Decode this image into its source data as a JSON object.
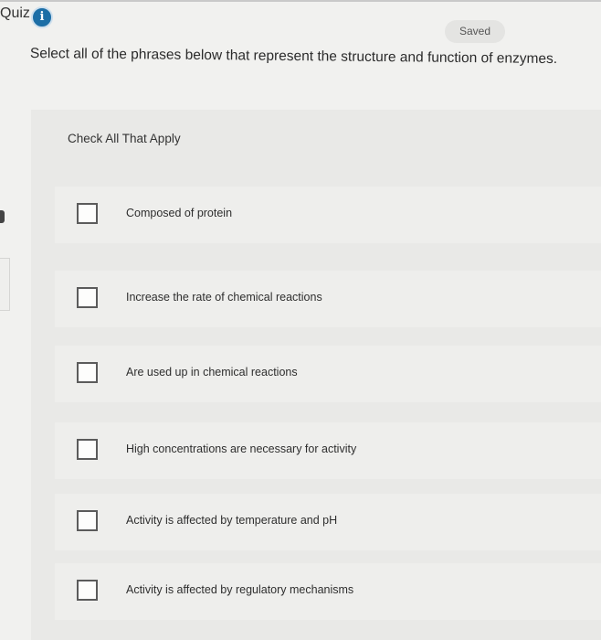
{
  "header": {
    "quiz_label": "Quiz",
    "info_icon": "i",
    "saved_label": "Saved"
  },
  "question": {
    "text": "Select all of the phrases below that represent the structure and function of enzymes."
  },
  "panel": {
    "instruction": "Check All That Apply",
    "options": [
      {
        "label": "Composed of protein",
        "checked": false
      },
      {
        "label": "Increase the rate of chemical reactions",
        "checked": false
      },
      {
        "label": "Are used up in chemical reactions",
        "checked": false
      },
      {
        "label": "High concentrations are necessary for activity",
        "checked": false
      },
      {
        "label": "Activity is affected by temperature and pH",
        "checked": false
      },
      {
        "label": "Activity is affected by regulatory mechanisms",
        "checked": false
      }
    ]
  },
  "colors": {
    "info_icon": "#1c6ea6",
    "background": "#f1f1ef",
    "panel": "#e9e9e7"
  }
}
